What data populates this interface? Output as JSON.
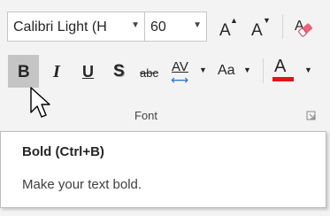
{
  "ribbon": {
    "font_name": "Calibri Light (H",
    "font_size": "60",
    "group_label": "Font",
    "buttons": {
      "bold": "B",
      "italic": "I",
      "underline": "U",
      "shadow": "S",
      "strikethrough": "abc",
      "char_spacing": "AV",
      "change_case": "Aa",
      "font_color": "A",
      "grow_font": "A",
      "shrink_font": "A"
    },
    "icons": {
      "grow": "grow-font-icon",
      "shrink": "shrink-font-icon",
      "clear": "clear-formatting-icon",
      "launcher": "dialog-launcher-icon"
    },
    "colors": {
      "font_color_bar": "#e0141e",
      "bold_pressed_bg": "#c5c5c5",
      "char_spacing_arrow": "#2b6cd3"
    }
  },
  "tooltip": {
    "title": "Bold (Ctrl+B)",
    "description": "Make your text bold."
  }
}
